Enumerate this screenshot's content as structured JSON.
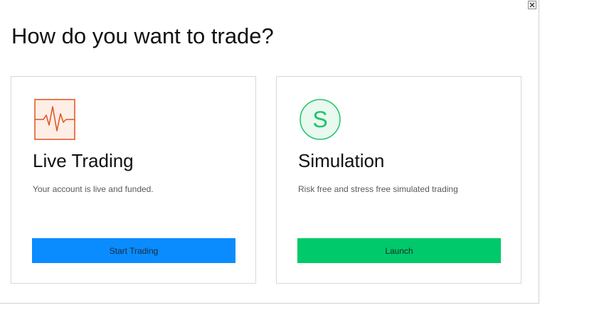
{
  "dialog": {
    "title": "How do you want to trade?",
    "close_icon": "close-icon"
  },
  "cards": [
    {
      "id": "live",
      "icon": "heartbeat-chart-icon",
      "icon_color": "#e0531f",
      "title": "Live Trading",
      "description": "Your account is live and funded.",
      "button_label": "Start Trading",
      "button_color": "#0a8cff"
    },
    {
      "id": "sim",
      "icon": "simulation-s-icon",
      "icon_letter": "S",
      "icon_color": "#1fc46a",
      "title": "Simulation",
      "description": "Risk free and stress free simulated trading",
      "button_label": "Launch",
      "button_color": "#00c96b"
    }
  ]
}
